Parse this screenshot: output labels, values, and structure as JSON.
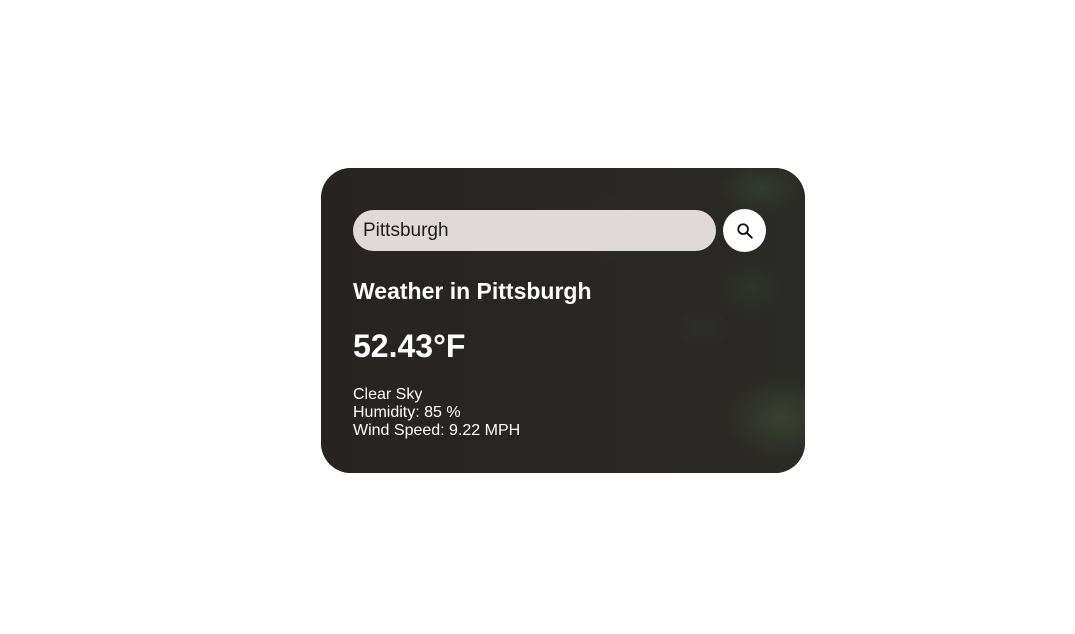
{
  "search": {
    "value": "Pittsburgh",
    "button_icon": "search-icon"
  },
  "weather": {
    "title": "Weather in Pittsburgh",
    "temperature": "52.43°F",
    "description": "Clear Sky",
    "humidity": "Humidity: 85 %",
    "wind": "Wind Speed: 9.22 MPH"
  },
  "colors": {
    "card_background": "#262220",
    "input_background": "#e0d9d9",
    "text": "#ffffff"
  }
}
